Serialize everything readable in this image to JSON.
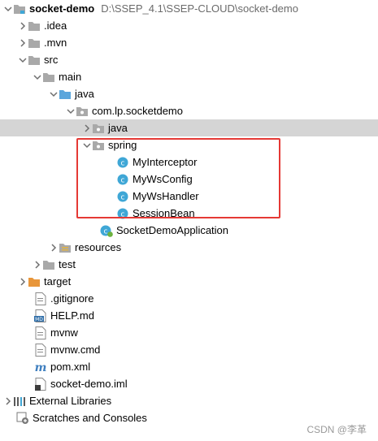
{
  "project": {
    "name": "socket-demo",
    "path": "D:\\SSEP_4.1\\SSEP-CLOUD\\socket-demo"
  },
  "tree": {
    "idea": ".idea",
    "mvn": ".mvn",
    "src": "src",
    "main": "main",
    "java": "java",
    "package": "com.lp.socketdemo",
    "java_sub": "java",
    "spring": "spring",
    "classes": [
      "MyInterceptor",
      "MyWsConfig",
      "MyWsHandler",
      "SessionBean"
    ],
    "app_class": "SocketDemoApplication",
    "resources": "resources",
    "test": "test",
    "target": "target",
    "files": [
      ".gitignore",
      "HELP.md",
      "mvnw",
      "mvnw.cmd",
      "pom.xml",
      "socket-demo.iml"
    ],
    "external_libraries": "External Libraries",
    "scratches": "Scratches and Consoles"
  },
  "watermark": "CSDN @李革",
  "colors": {
    "selection": "#d5d5d5",
    "highlight_border": "#e53935",
    "class_icon": "#3fa7d6"
  }
}
